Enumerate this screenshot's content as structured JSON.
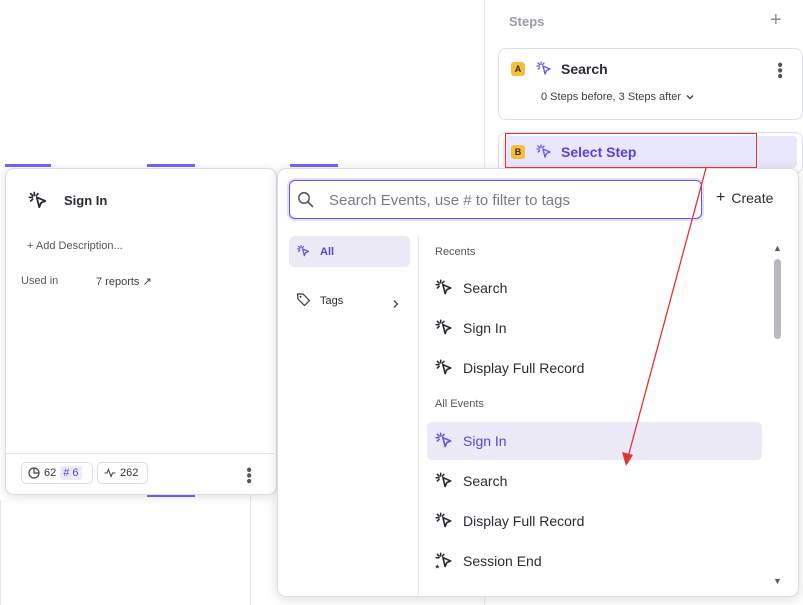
{
  "steps": {
    "title": "Steps",
    "add_icon": "plus-icon",
    "step_a": {
      "letter": "A",
      "name": "Search",
      "sub": "0 Steps before, 3 Steps after"
    },
    "step_b": {
      "letter": "B",
      "name": "Select Step"
    }
  },
  "event_card": {
    "title": "Sign In",
    "add_description": "+ Add Description...",
    "used_in_label": "Used in",
    "used_in_value": "7 reports ↗",
    "views_count": "62",
    "tag_count": "# 6",
    "volume_count": "262"
  },
  "picker": {
    "search_placeholder": "Search Events, use # to filter to tags",
    "create_label": "Create",
    "nav": [
      {
        "label": "All"
      },
      {
        "label": "Tags"
      }
    ],
    "recents_label": "Recents",
    "recents": [
      {
        "label": "Search"
      },
      {
        "label": "Sign In"
      },
      {
        "label": "Display Full Record"
      }
    ],
    "all_events_label": "All Events",
    "all_events": [
      {
        "label": "Sign In"
      },
      {
        "label": "Search"
      },
      {
        "label": "Display Full Record"
      },
      {
        "label": "Session End"
      }
    ]
  },
  "colors": {
    "accent": "#5b3fd9",
    "step_badge": "#f5be3d",
    "annotation": "#e03434"
  }
}
